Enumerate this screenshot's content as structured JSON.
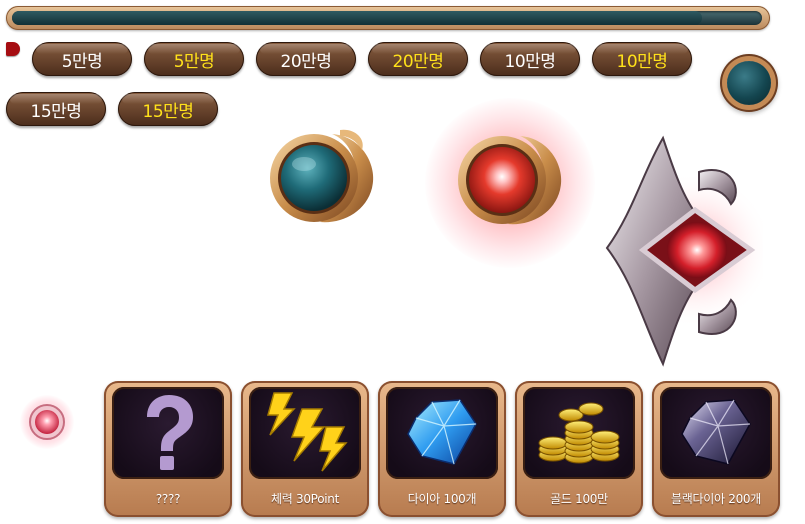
{
  "progress": {
    "fill_percent": 92
  },
  "reward_buttons": [
    {
      "label": "5만명",
      "color": "#ffffff"
    },
    {
      "label": "5만명",
      "color": "#ffe11a"
    },
    {
      "label": "20만명",
      "color": "#ffffff"
    },
    {
      "label": "20만명",
      "color": "#ffe11a"
    },
    {
      "label": "10만명",
      "color": "#ffffff"
    },
    {
      "label": "10만명",
      "color": "#ffe11a"
    },
    {
      "label": "15만명",
      "color": "#ffffff"
    },
    {
      "label": "15만명",
      "color": "#ffe11a"
    }
  ],
  "rewards": [
    {
      "label": "????",
      "icon": "question-mark-icon"
    },
    {
      "label": "체력 30Point",
      "icon": "lightning-icon"
    },
    {
      "label": "다이아 100개",
      "icon": "blue-diamond-icon"
    },
    {
      "label": "골드 100만",
      "icon": "gold-coins-icon"
    },
    {
      "label": "블랙다이아 200개",
      "icon": "black-diamond-icon"
    }
  ]
}
